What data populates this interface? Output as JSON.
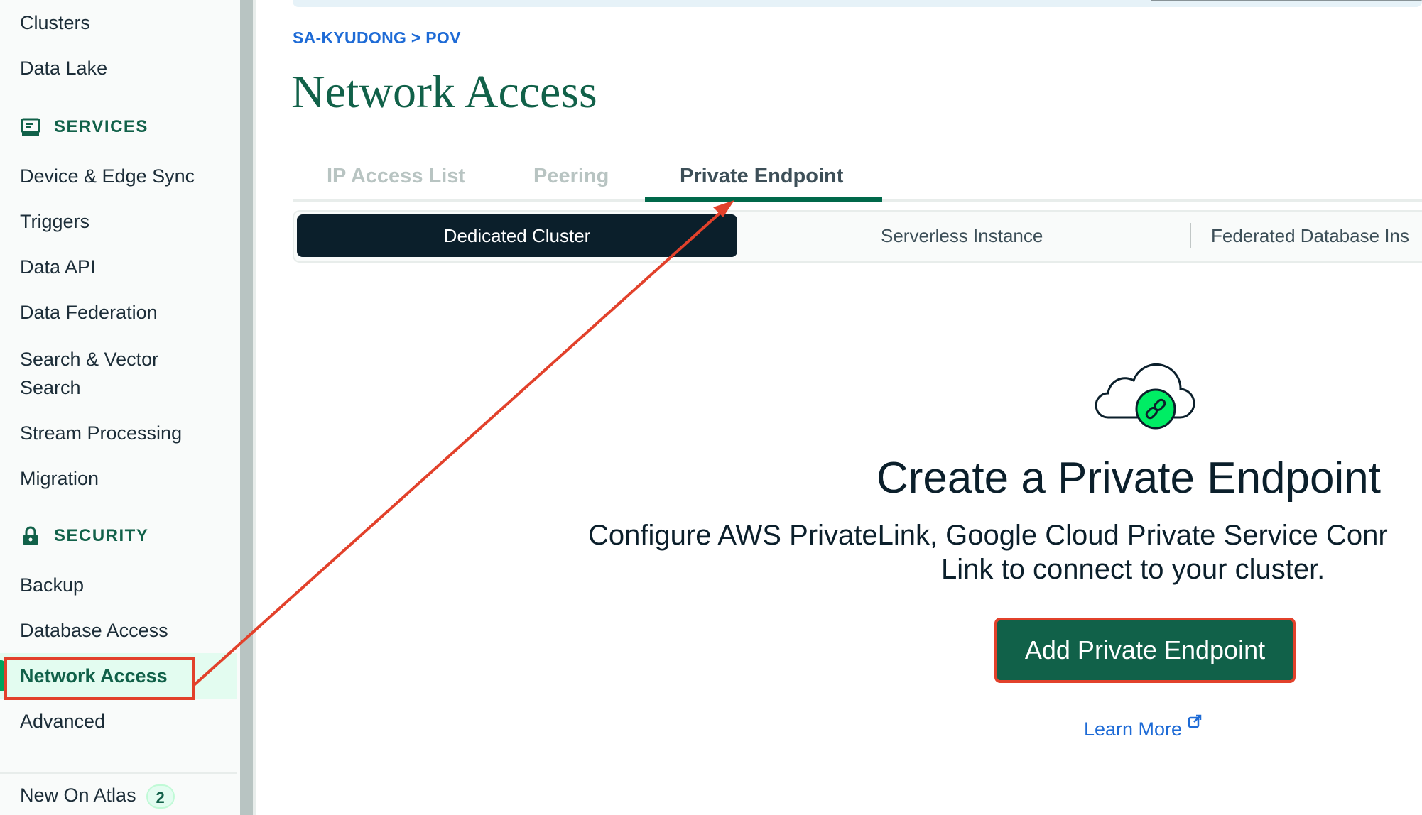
{
  "sidebar": {
    "items_top": [
      {
        "label": "Clusters"
      },
      {
        "label": "Data Lake"
      }
    ],
    "services_heading": "SERVICES",
    "services_items": [
      {
        "label": "Device & Edge Sync"
      },
      {
        "label": "Triggers"
      },
      {
        "label": "Data API"
      },
      {
        "label": "Data Federation"
      },
      {
        "label": "Search & Vector"
      },
      {
        "label": "Search"
      },
      {
        "label": "Stream Processing"
      },
      {
        "label": "Migration"
      }
    ],
    "security_heading": "SECURITY",
    "security_items": [
      {
        "label": "Backup"
      },
      {
        "label": "Database Access"
      },
      {
        "label": "Network Access"
      },
      {
        "label": "Advanced"
      }
    ],
    "new_on_atlas": {
      "label": "New On Atlas",
      "count": "2"
    }
  },
  "main": {
    "breadcrumb": "SA-KYUDONG > POV",
    "title": "Network Access",
    "tabs": [
      {
        "label": "IP Access List"
      },
      {
        "label": "Peering"
      },
      {
        "label": "Private Endpoint"
      }
    ],
    "segments": [
      {
        "label": "Dedicated Cluster"
      },
      {
        "label": "Serverless Instance"
      },
      {
        "label": "Federated Database Ins"
      }
    ],
    "empty_state": {
      "title": "Create a Private Endpoint",
      "description_line1": "Configure AWS PrivateLink, Google Cloud Private Service Conr",
      "description_line2": "Link to connect to your cluster.",
      "button": "Add Private Endpoint",
      "learn_more": "Learn More"
    }
  },
  "colors": {
    "brand_green": "#116149",
    "accent_green": "#00a35c",
    "link_blue": "#1e6bd6",
    "annotation_red": "#e2412b",
    "dark_navy": "#0b1f2b"
  },
  "icons": [
    "services-icon",
    "lock-icon",
    "cloud-link-icon",
    "external-link-icon"
  ]
}
